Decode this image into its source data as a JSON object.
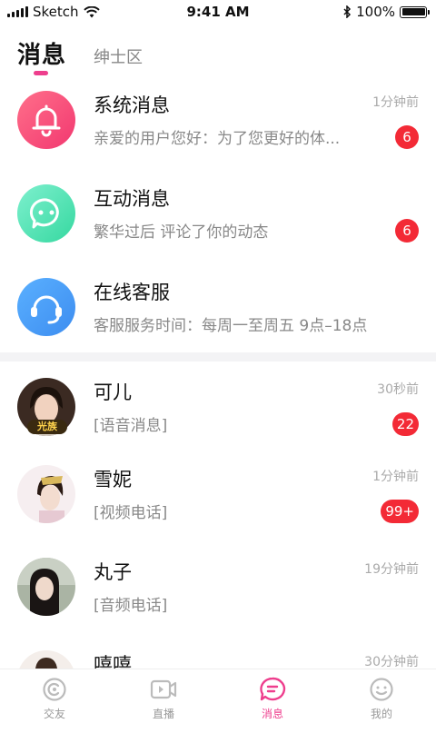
{
  "status_bar": {
    "carrier": "Sketch",
    "time": "9:41 AM",
    "battery": "100%",
    "battery_level": 1.0
  },
  "top_tabs": [
    {
      "label": "消息",
      "active": true
    },
    {
      "label": "绅士区",
      "active": false
    }
  ],
  "system_rows": [
    {
      "title": "系统消息",
      "subtitle": "亲爱的用户您好：为了您更好的体...",
      "time": "1分钟前",
      "badge": "6",
      "icon": "bell-icon"
    },
    {
      "title": "互动消息",
      "subtitle": "繁华过后 评论了你的动态",
      "time": "",
      "badge": "6",
      "icon": "chat-bubble-icon"
    },
    {
      "title": "在线客服",
      "subtitle": "客服服务时间：每周一至周五 9点–18点",
      "time": "",
      "badge": "",
      "icon": "headset-icon"
    }
  ],
  "chat_rows": [
    {
      "name": "可儿",
      "message": "[语音消息]",
      "time": "30秒前",
      "badge": "22",
      "medal": "光族"
    },
    {
      "name": "雪妮",
      "message": "[视频电话]",
      "time": "1分钟前",
      "badge": "99+"
    },
    {
      "name": "丸子",
      "message": "[音频电话]",
      "time": "19分钟前",
      "badge": ""
    },
    {
      "name": "嘻嘻",
      "message": "",
      "time": "30分钟前",
      "badge": ""
    }
  ],
  "bottom_nav": [
    {
      "label": "交友",
      "icon": "friends-icon",
      "active": false
    },
    {
      "label": "直播",
      "icon": "live-icon",
      "active": false
    },
    {
      "label": "消息",
      "icon": "message-icon",
      "active": true
    },
    {
      "label": "我的",
      "icon": "profile-icon",
      "active": false
    }
  ],
  "colors": {
    "accent": "#ee3e8d",
    "badge": "#f32a36"
  }
}
